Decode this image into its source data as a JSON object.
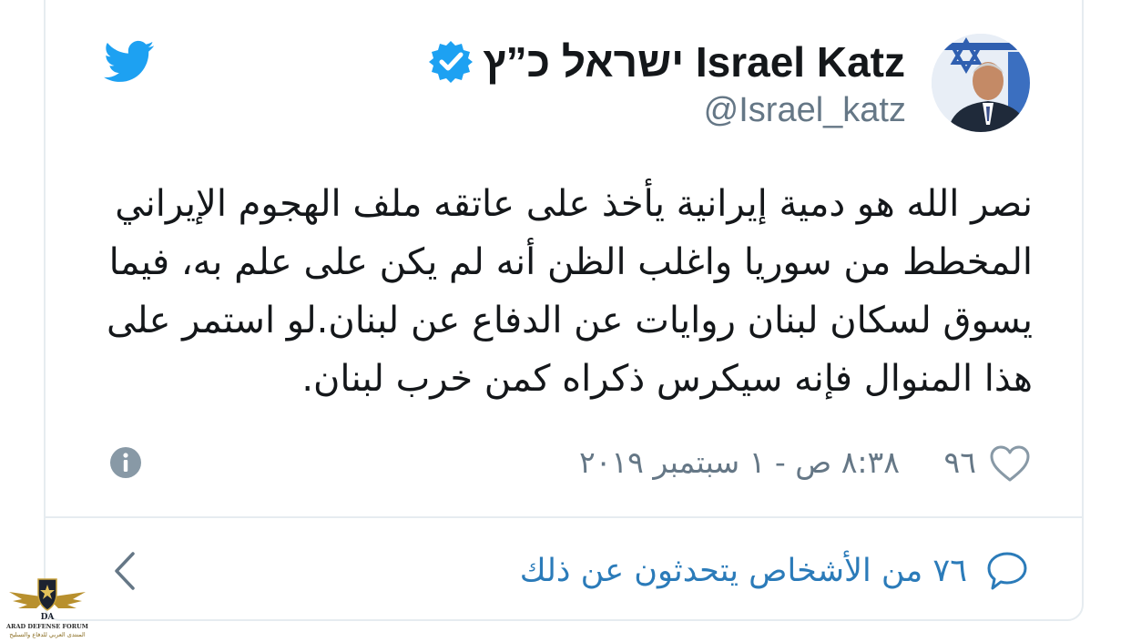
{
  "tweet": {
    "author": {
      "display_name": "ישראל כ”ץ Israel Katz",
      "handle": "@Israel_katz",
      "verified": true,
      "avatar_icon": "profile-photo-with-star-of-david-flag"
    },
    "text": "نصر الله هو دمية إيرانية يأخذ على عاتقه ملف الهجوم الإيراني المخطط من سوريا واغلب الظن أنه لم يكن على علم به، فيما يسوق لسكان لبنان روايات عن الدفاع  عن لبنان.لو استمر على هذا المنوال فإنه سيكرس ذكراه كمن خرب  لبنان.",
    "like_count": "٩٦",
    "timestamp": "٨:٣٨ ص - ١ سبتمبر ٢٠١٩",
    "conversation_link": "٧٦ من الأشخاص يتحدثون عن ذلك"
  },
  "icons": {
    "brand": "twitter-bird-icon",
    "verified": "verified-badge-icon",
    "like": "heart-icon",
    "info": "info-icon",
    "reply": "speech-bubble-icon",
    "back": "chevron-left-icon"
  },
  "watermark": {
    "title": "ARAD DEFENSE FORUM",
    "subtitle": "المنتدى العربي للدفاع والتسليح",
    "monogram": "DA"
  },
  "colors": {
    "twitter_blue": "#1da1f2",
    "link_blue": "#2b7bb9",
    "text": "#14171a",
    "muted": "#657786",
    "border": "#e6ecf0"
  }
}
